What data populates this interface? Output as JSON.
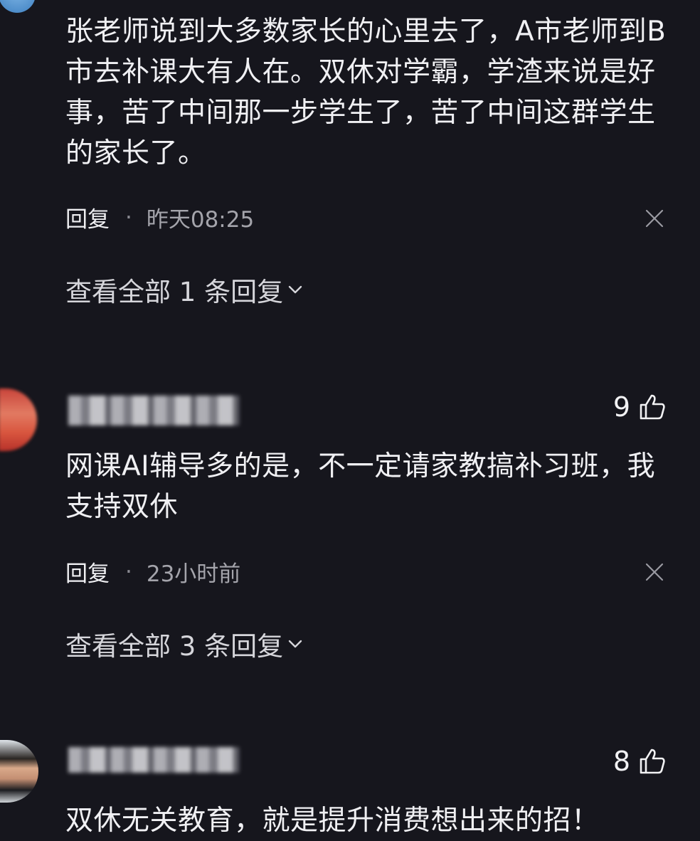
{
  "comments": [
    {
      "text": "张老师说到大多数家长的心里去了，A市老师到B市去补课大有人在。双休对学霸，学渣来说是好事，苦了中间那一步学生了，苦了中间这群学生的家长了。",
      "reply_label": "回复",
      "separator": "·",
      "time": "昨天08:25",
      "view_all": "查看全部 1 条回复"
    },
    {
      "likes": "9",
      "text": "网课AI辅导多的是，不一定请家教搞补习班，我支持双休",
      "reply_label": "回复",
      "separator": "·",
      "time": "23小时前",
      "view_all": "查看全部 3 条回复"
    },
    {
      "likes": "8",
      "text": "双休无关教育，就是提升消费想出来的招！"
    }
  ],
  "icons": {
    "like": "thumbs-up-icon",
    "close": "close-icon",
    "expand": "chevron-down-icon"
  },
  "colors": {
    "background": "#16161d",
    "text": "#f0f0f3",
    "muted": "#a4a4ab"
  }
}
